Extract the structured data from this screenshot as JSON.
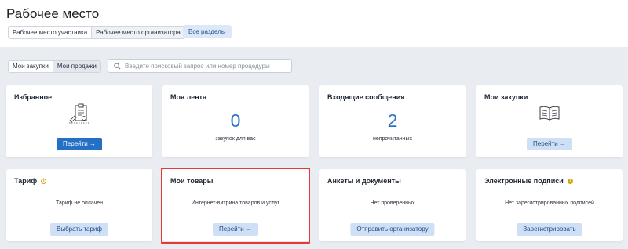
{
  "header": {
    "title": "Рабочее место",
    "tabs": [
      "Рабочее место участника",
      "Рабочее место организатора"
    ],
    "all_sections_label": "Все разделы"
  },
  "filter": {
    "tabs": [
      "Мои закупки",
      "Мои продажи"
    ],
    "search_placeholder": "Введите поисковый запрос или номер процедуры"
  },
  "cards": {
    "favorites": {
      "title": "Избранное",
      "button": "Перейти →",
      "icon": "clipboard-document-icon"
    },
    "feed": {
      "title": "Моя лента",
      "value": "0",
      "caption": "закупок для вас"
    },
    "messages": {
      "title": "Входящие сообщения",
      "value": "2",
      "caption": "непрочитанных"
    },
    "purchases": {
      "title": "Мои закупки",
      "button": "Перейти →",
      "icon": "open-book-icon"
    },
    "tariff": {
      "title": "Тариф",
      "caption": "Тариф не оплачен",
      "button": "Выбрать тариф",
      "badge_icon": "info-icon"
    },
    "goods": {
      "title": "Мои товары",
      "caption": "Интернет-витрина товаров и услуг",
      "button": "Перейти →"
    },
    "forms": {
      "title": "Анкеты и документы",
      "caption": "Нет проверенных",
      "button": "Отправить организатору"
    },
    "signatures": {
      "title": "Электронные подписи",
      "caption": "Нет зарегистрированных подписей",
      "button": "Зарегистрировать",
      "badge_icon": "warning-icon"
    }
  },
  "colors": {
    "accent": "#2570c4",
    "number": "#2a74c6",
    "highlight": "#e53936",
    "background": "#e9ecf0"
  }
}
